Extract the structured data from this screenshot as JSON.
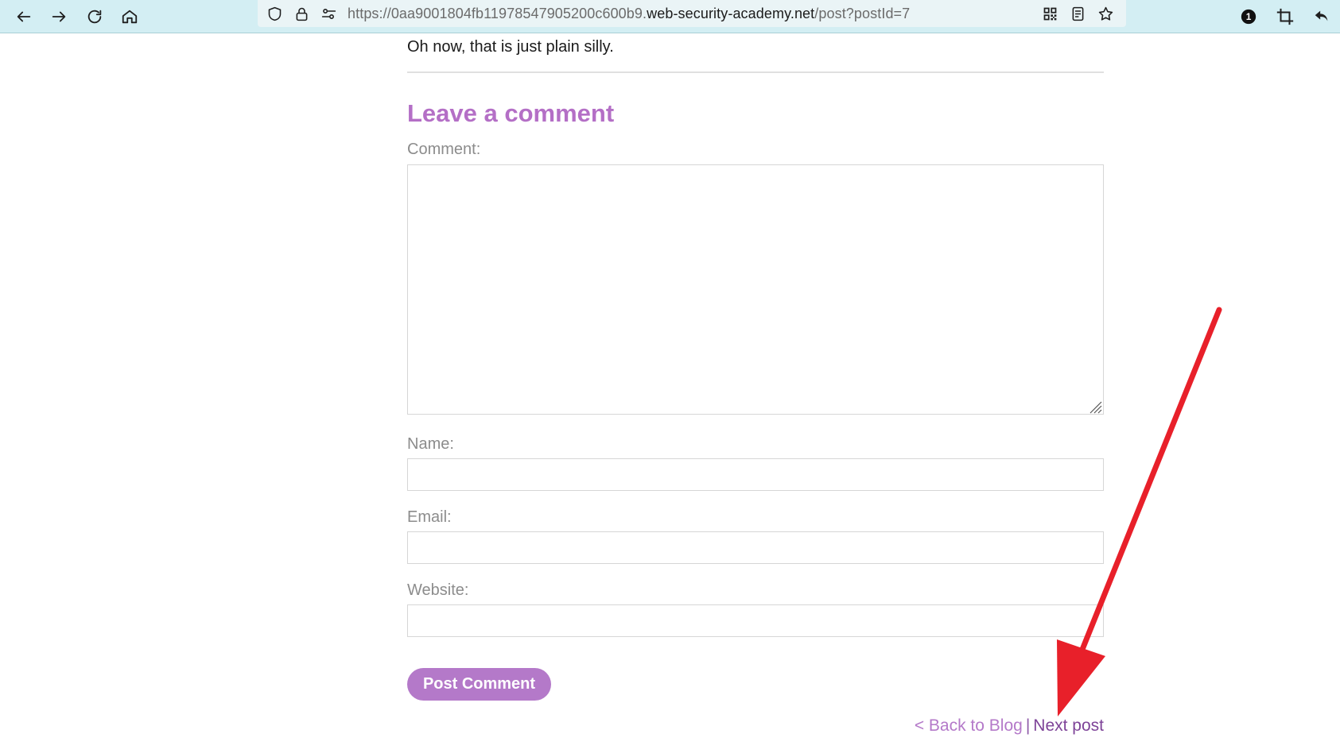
{
  "browser": {
    "url_prefix": "https://0aa9001804fb11978547905200c600b9.",
    "url_domain": "web-security-academy.net",
    "url_path": "/post?postId=7",
    "notification_count": "1",
    "icons": {
      "back": "arrow-left-icon",
      "forward": "arrow-right-icon",
      "reload": "reload-icon",
      "home": "home-icon",
      "tracking": "shield-icon",
      "secure": "lock-icon",
      "permissions": "sliders-icon",
      "qr": "qr-code-icon",
      "reader": "reader-view-icon",
      "bookmark": "star-icon",
      "extension": "crop-icon",
      "reply": "undo-arrow-icon"
    }
  },
  "post": {
    "last_comment": "Oh now, that is just plain silly."
  },
  "comment_form": {
    "heading": "Leave a comment",
    "comment_label": "Comment:",
    "comment_value": "",
    "name_label": "Name:",
    "name_value": "",
    "email_label": "Email:",
    "email_value": "",
    "website_label": "Website:",
    "website_value": "",
    "submit_label": "Post Comment"
  },
  "navigation": {
    "back_label": "< Back to Blog",
    "separator": "|",
    "next_label": "Next post"
  },
  "colors": {
    "accent": "#b479c9",
    "heading": "#b46fc6",
    "toolbar_bg": "#d3eef3",
    "annotation_arrow": "#e8202a"
  }
}
